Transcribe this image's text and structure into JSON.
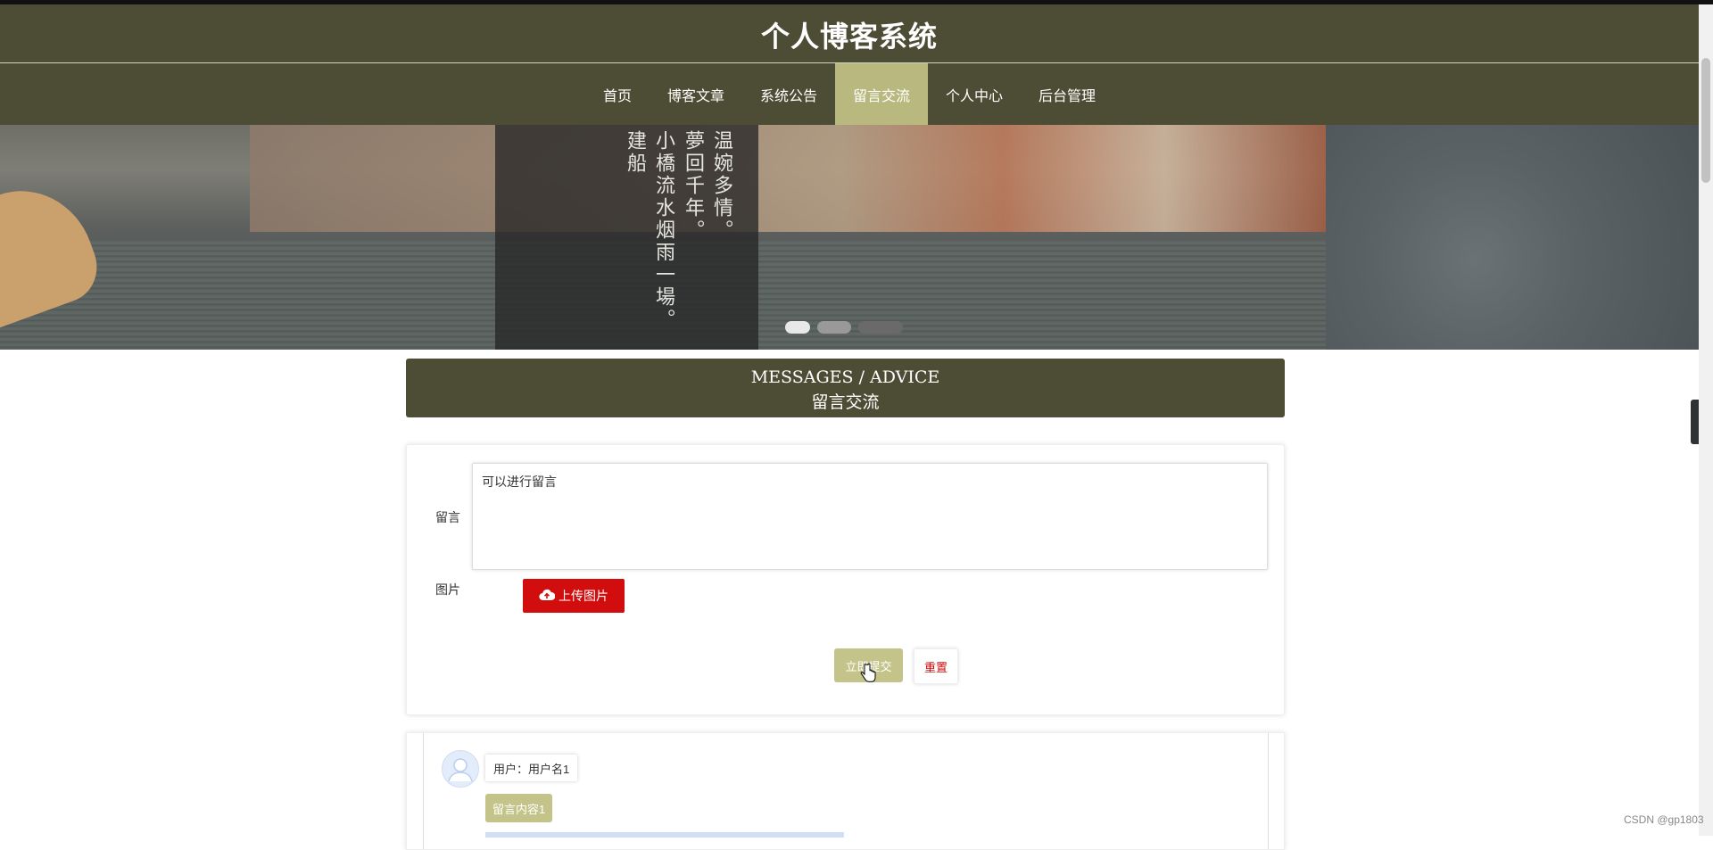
{
  "site": {
    "title": "个人博客系统"
  },
  "nav": {
    "items": [
      {
        "label": "首页",
        "active": false
      },
      {
        "label": "博客文章",
        "active": false
      },
      {
        "label": "系统公告",
        "active": false
      },
      {
        "label": "留言交流",
        "active": true
      },
      {
        "label": "个人中心",
        "active": false
      },
      {
        "label": "后台管理",
        "active": false
      }
    ]
  },
  "banner": {
    "poem": [
      "建船",
      "小橋流水烟雨一場。",
      "夢回千年。",
      "温婉多情。"
    ],
    "slides": 3,
    "active_slide": 0
  },
  "section": {
    "title_en": "MESSAGES / ADVICE",
    "title_cn": "留言交流"
  },
  "form": {
    "message_label": "留言",
    "message_value": "可以进行留言",
    "image_label": "图片",
    "upload_label": "上传图片",
    "submit_label": "立即提交",
    "reset_label": "重置"
  },
  "comments": [
    {
      "user_label": "用户：用户名1",
      "content": "留言内容1"
    }
  ],
  "colors": {
    "primary": "#4d4d35",
    "accent": "#b8b87f",
    "button": "#c3c38a",
    "danger": "#d20d0d"
  },
  "watermark": "CSDN @gp1803"
}
